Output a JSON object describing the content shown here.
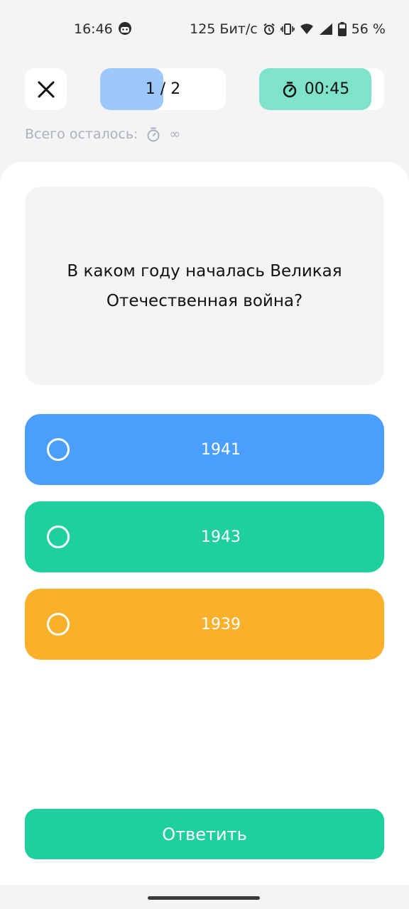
{
  "status_bar": {
    "time": "16:46",
    "network_speed": "125 Бит/с",
    "battery": "56 %",
    "icons": [
      "face-icon",
      "alarm-icon",
      "vibrate-icon",
      "wifi-icon",
      "signal-icon",
      "battery-icon"
    ]
  },
  "header": {
    "close_icon": "close-icon",
    "progress_text": "1 / 2",
    "progress_fraction": 0.5,
    "timer_text": "00:45",
    "timer_fraction": 0.9,
    "timer_icon": "stopwatch-icon"
  },
  "remaining": {
    "label": "Всего осталось:",
    "value": "∞",
    "icon": "stopwatch-icon"
  },
  "question": {
    "text": "В каком году началась Великая Отечественная война?"
  },
  "answers": [
    {
      "label": "1941",
      "color": "#4b9ffc"
    },
    {
      "label": "1943",
      "color": "#1fcf9e"
    },
    {
      "label": "1939",
      "color": "#fbb02b"
    }
  ],
  "submit": {
    "label": "Ответить",
    "color": "#1fcf9e"
  }
}
